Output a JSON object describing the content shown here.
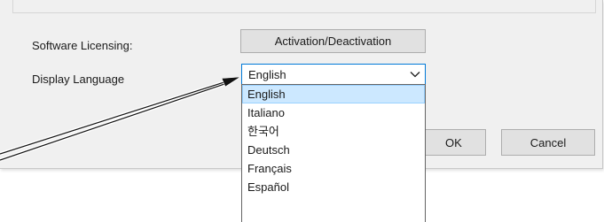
{
  "settings": {
    "licensing_label": "Software Licensing:",
    "activation_button": "Activation/Deactivation",
    "language_label": "Display Language",
    "language_selected": "English"
  },
  "dropdown": {
    "options": [
      "English",
      "Italiano",
      "한국어",
      "Deutsch",
      "Français",
      "Español"
    ],
    "selected_index": 0
  },
  "footer": {
    "ok_label": "OK",
    "cancel_label": "Cancel"
  },
  "icons": {
    "select_chevron": "chevron-down-icon",
    "callout": "callout-arrow-icon"
  },
  "colors": {
    "dialog_bg": "#f0f0f0",
    "focus_border": "#0078d7",
    "highlight_bg": "#cce8ff",
    "highlight_border": "#99d1ff",
    "button_bg": "#e1e1e1"
  }
}
